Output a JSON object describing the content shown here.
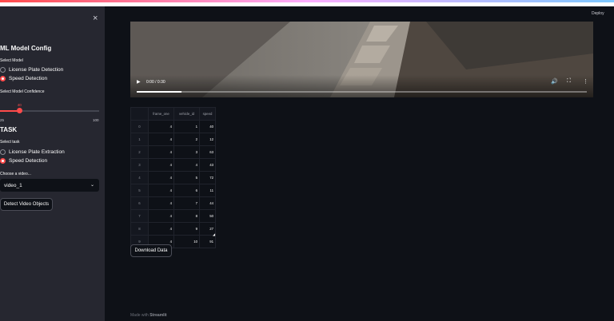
{
  "sidebar": {
    "close_label": "×",
    "config_title": "ML Model Config",
    "select_model_label": "Select Model",
    "model_options": [
      "License Plate Detection",
      "Speed Detection"
    ],
    "model_selected_index": 1,
    "confidence_label": "Select Model Confidence",
    "confidence_value": "40",
    "confidence_min": "25",
    "confidence_max": "100",
    "task_title": "TASK",
    "select_task_label": "Select task",
    "task_options": [
      "License Plate Extraction",
      "Speed Detection"
    ],
    "task_selected_index": 1,
    "video_choose_label": "Choose a video...",
    "video_selected": "video_1",
    "detect_button_label": "Detect Video Objects"
  },
  "header": {
    "deploy_label": "Deploy"
  },
  "video": {
    "time_display": "0:00 / 0:30",
    "progress_fraction": 0.1
  },
  "table": {
    "columns": [
      "",
      "frame_one",
      "vehicle_id",
      "speed"
    ],
    "rows": [
      [
        "0",
        "4",
        "1",
        "40"
      ],
      [
        "1",
        "4",
        "2",
        "12"
      ],
      [
        "2",
        "4",
        "3",
        "63"
      ],
      [
        "3",
        "4",
        "4",
        "43"
      ],
      [
        "4",
        "4",
        "5",
        "72"
      ],
      [
        "5",
        "4",
        "6",
        "11"
      ],
      [
        "6",
        "4",
        "7",
        "44"
      ],
      [
        "7",
        "4",
        "8",
        "50"
      ],
      [
        "8",
        "4",
        "9",
        "27"
      ],
      [
        "9",
        "4",
        "10",
        "91"
      ]
    ]
  },
  "download_button_label": "Download Data",
  "footer": {
    "prefix": "Made with ",
    "brand": "Streamlit"
  },
  "colors": {
    "accent": "#ff4b4b",
    "background": "#0e1117",
    "sidebar": "#262730"
  },
  "icons": [
    "close-icon",
    "chevron-down-icon",
    "play-icon",
    "volume-icon",
    "fullscreen-icon",
    "more-options-icon",
    "resize-handle-icon"
  ]
}
